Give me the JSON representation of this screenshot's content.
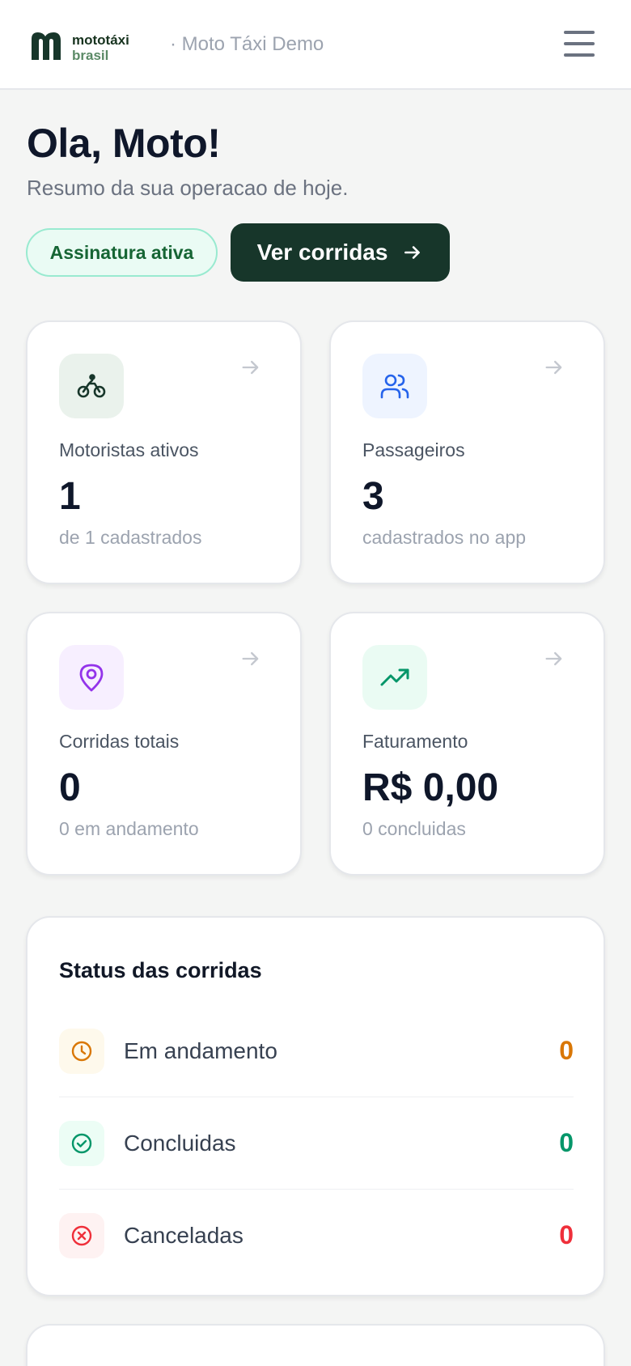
{
  "header": {
    "logo_line1": "mototáxi",
    "logo_line2": "brasil",
    "tenant": "· Moto Táxi Demo",
    "menu_icon": "hamburger-menu-icon"
  },
  "hero": {
    "greeting": "Ola, Moto!",
    "subtitle": "Resumo da sua operacao de hoje.",
    "badge": "Assinatura ativa",
    "cta_label": "Ver corridas"
  },
  "stats": [
    {
      "icon": "motorcycle-icon",
      "label": "Motoristas ativos",
      "value": "1",
      "sub": "de 1 cadastrados",
      "icon_color": "#17362a",
      "icon_bg": "#eaf2ec"
    },
    {
      "icon": "users-icon",
      "label": "Passageiros",
      "value": "3",
      "sub": "cadastrados no app",
      "icon_color": "#2563eb",
      "icon_bg": "#eef4ff"
    },
    {
      "icon": "map-pin-icon",
      "label": "Corridas totais",
      "value": "0",
      "sub": "0 em andamento",
      "icon_color": "#9333ea",
      "icon_bg": "#f7efff"
    },
    {
      "icon": "trending-up-icon",
      "label": "Faturamento",
      "value": "R$ 0,00",
      "sub": "0 concluidas",
      "icon_color": "#059669",
      "icon_bg": "#eafbf3"
    }
  ],
  "status": {
    "title": "Status das corridas",
    "rows": [
      {
        "icon": "clock-icon",
        "label": "Em andamento",
        "count": "0",
        "color": "#d97706",
        "bg": "#fef9ec"
      },
      {
        "icon": "check-circle-icon",
        "label": "Concluidas",
        "count": "0",
        "color": "#059669",
        "bg": "#ecfdf5"
      },
      {
        "icon": "x-circle-icon",
        "label": "Canceladas",
        "count": "0",
        "color": "#ef2f3a",
        "bg": "#fef2f2"
      }
    ]
  }
}
